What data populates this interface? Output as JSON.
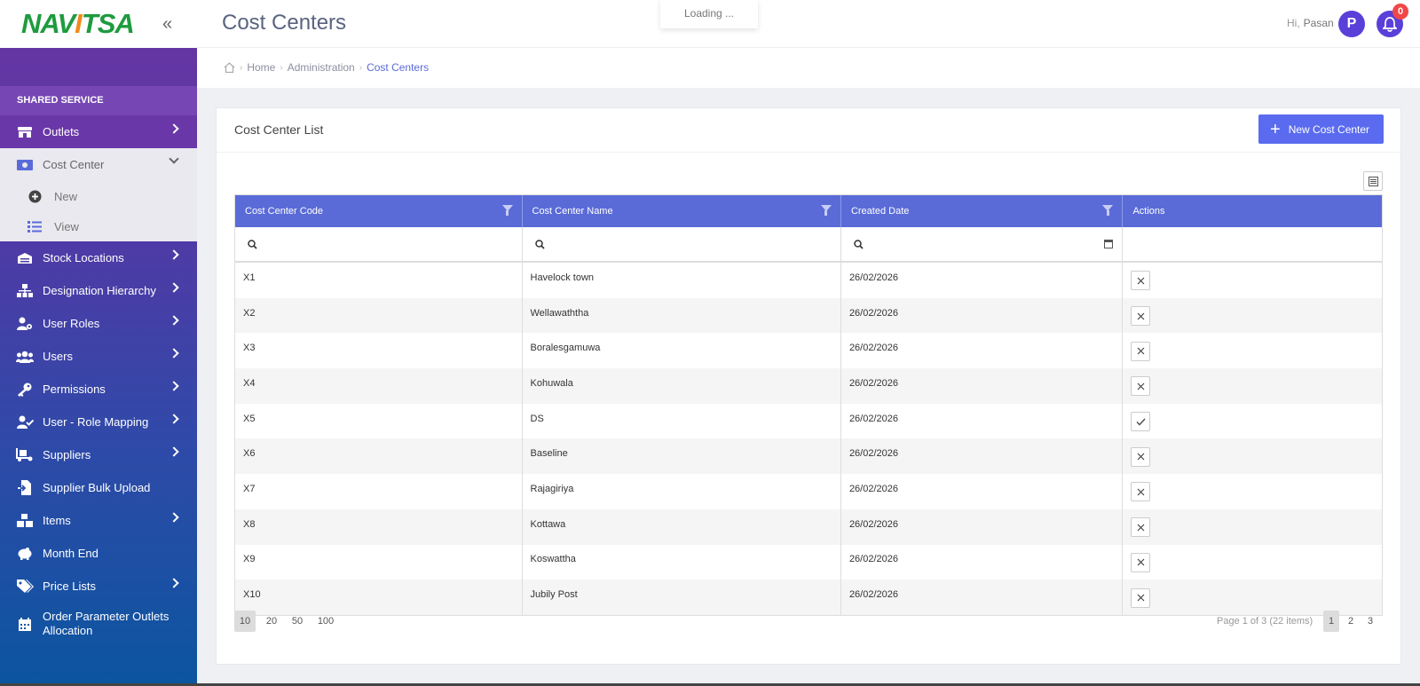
{
  "app": {
    "logo_main": "NAV",
    "logo_accent": "I",
    "logo_rest": "TSA",
    "collapse_glyph": "«",
    "page_title": "Cost Centers",
    "loading_text": "Loading ...",
    "greeting": "Hi,",
    "user_name": "Pasan",
    "avatar_initial": "P",
    "notification_count": "0"
  },
  "breadcrumb": {
    "home": "Home",
    "admin": "Administration",
    "current": "Cost Centers"
  },
  "sidebar": {
    "section": "SHARED SERVICE",
    "items": [
      {
        "label": "Outlets",
        "icon": "store-icon"
      },
      {
        "label": "Cost Center",
        "icon": "money-icon"
      },
      {
        "label": "Stock Locations",
        "icon": "warehouse-icon"
      },
      {
        "label": "Designation Hierarchy",
        "icon": "hierarchy-icon"
      },
      {
        "label": "User Roles",
        "icon": "user-cog-icon"
      },
      {
        "label": "Users",
        "icon": "users-icon"
      },
      {
        "label": "Permissions",
        "icon": "key-icon"
      },
      {
        "label": "User - Role Mapping",
        "icon": "user-check-icon"
      },
      {
        "label": "Suppliers",
        "icon": "truck-icon"
      },
      {
        "label": "Supplier Bulk Upload",
        "icon": "file-import-icon"
      },
      {
        "label": "Items",
        "icon": "boxes-icon"
      },
      {
        "label": "Month End",
        "icon": "piggy-bank-icon"
      },
      {
        "label": "Price Lists",
        "icon": "tags-icon"
      },
      {
        "label": "Order Parameter Outlets Allocation",
        "icon": "calendar-icon"
      }
    ],
    "sub_items": [
      {
        "label": "New",
        "icon": "plus-circle-icon"
      },
      {
        "label": "View",
        "icon": "list-icon"
      }
    ]
  },
  "card": {
    "title": "Cost Center List",
    "new_button": "New Cost Center"
  },
  "table": {
    "columns": [
      "Cost Center Code",
      "Cost Center Name",
      "Created Date",
      "Actions"
    ],
    "rows": [
      {
        "code": "X1",
        "name": "Havelock town",
        "date": "26/02/2026",
        "action": "x"
      },
      {
        "code": "X2",
        "name": "Wellawaththa",
        "date": "26/02/2026",
        "action": "x"
      },
      {
        "code": "X3",
        "name": "Boralesgamuwa",
        "date": "26/02/2026",
        "action": "x"
      },
      {
        "code": "X4",
        "name": "Kohuwala",
        "date": "26/02/2026",
        "action": "x"
      },
      {
        "code": "X5",
        "name": "DS",
        "date": "26/02/2026",
        "action": "check"
      },
      {
        "code": "X6",
        "name": "Baseline",
        "date": "26/02/2026",
        "action": "x"
      },
      {
        "code": "X7",
        "name": "Rajagiriya",
        "date": "26/02/2026",
        "action": "x"
      },
      {
        "code": "X8",
        "name": "Kottawa",
        "date": "26/02/2026",
        "action": "x"
      },
      {
        "code": "X9",
        "name": "Koswattha",
        "date": "26/02/2026",
        "action": "x"
      },
      {
        "code": "X10",
        "name": "Jubily Post",
        "date": "26/02/2026",
        "action": "x"
      }
    ]
  },
  "pager": {
    "sizes": [
      "10",
      "20",
      "50",
      "100"
    ],
    "selected_size": "10",
    "info": "Page 1 of 3 (22 items)",
    "pages": [
      "1",
      "2",
      "3"
    ],
    "current_page": "1"
  },
  "colors": {
    "accent": "#5a6bd8",
    "button": "#5a6bef",
    "badge": "#f04848",
    "logo_green": "#1e9b3f",
    "logo_orange": "#f08a1c"
  }
}
